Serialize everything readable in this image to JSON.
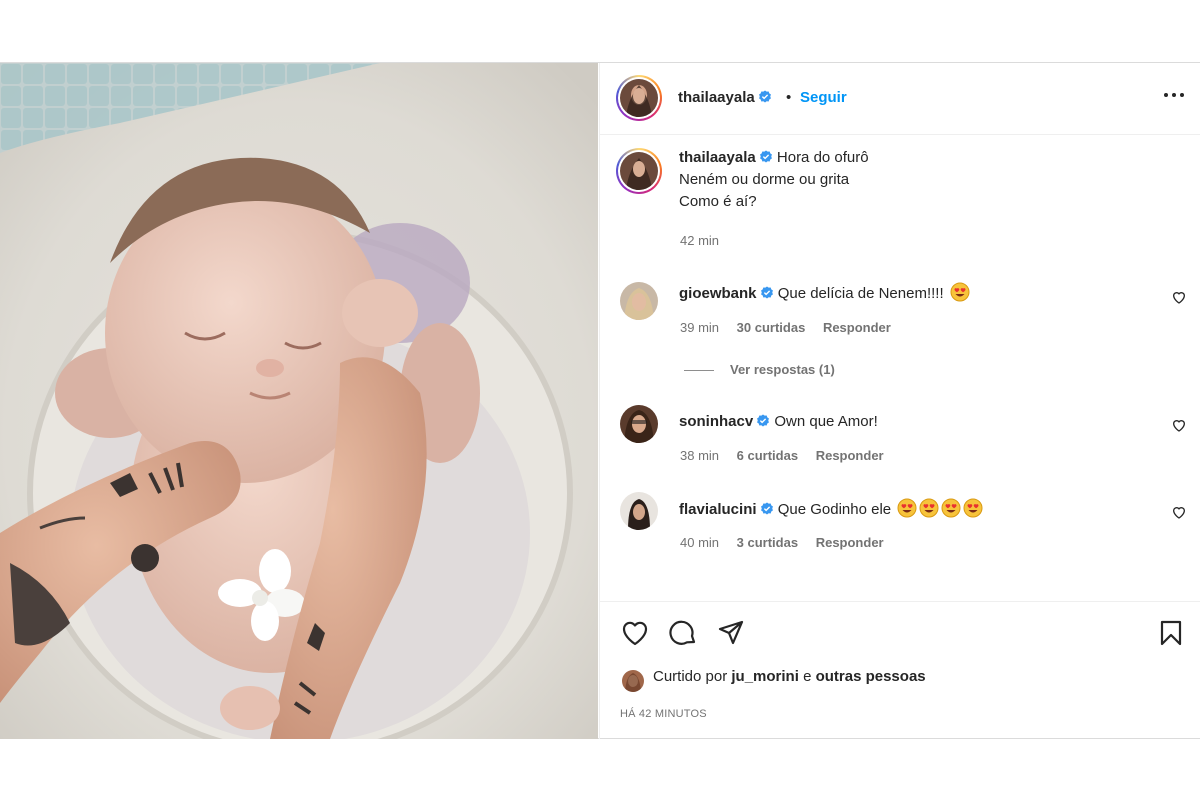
{
  "post": {
    "author": "thailaayala",
    "separator": "•",
    "follow_label": "Seguir"
  },
  "caption": {
    "user": "thailaayala",
    "lines": [
      "Hora do ofurô",
      "Neném ou dorme ou grita",
      "Como é aí?"
    ],
    "time": "42 min"
  },
  "comments": [
    {
      "user": "gioewbank",
      "text": "Que delícia de Nenem!!!!",
      "emoji_count": 1,
      "time": "39 min",
      "likes": "30 curtidas",
      "reply": "Responder",
      "view_replies": "Ver respostas (1)"
    },
    {
      "user": "soninhacv",
      "text": "Own que Amor!",
      "emoji_count": 0,
      "time": "38 min",
      "likes": "6 curtidas",
      "reply": "Responder"
    },
    {
      "user": "flavialucini",
      "text": "Que Godinho ele",
      "emoji_count": 4,
      "time": "40 min",
      "likes": "3 curtidas",
      "reply": "Responder"
    }
  ],
  "likes": {
    "prefix": "Curtido por",
    "user": "ju_morini",
    "conj": "e",
    "others": "outras pessoas"
  },
  "timestamp": "HÁ 42 MINUTOS",
  "icons": {
    "verified": "verified-badge-icon",
    "more": "more-options-icon",
    "like": "heart-icon",
    "comment": "comment-icon",
    "share": "send-icon",
    "save": "bookmark-icon",
    "emoji": "heart-eyes-emoji"
  },
  "colors": {
    "accent": "#0095f6",
    "text": "#262626",
    "muted": "#737373",
    "verified": "#3897f0"
  }
}
